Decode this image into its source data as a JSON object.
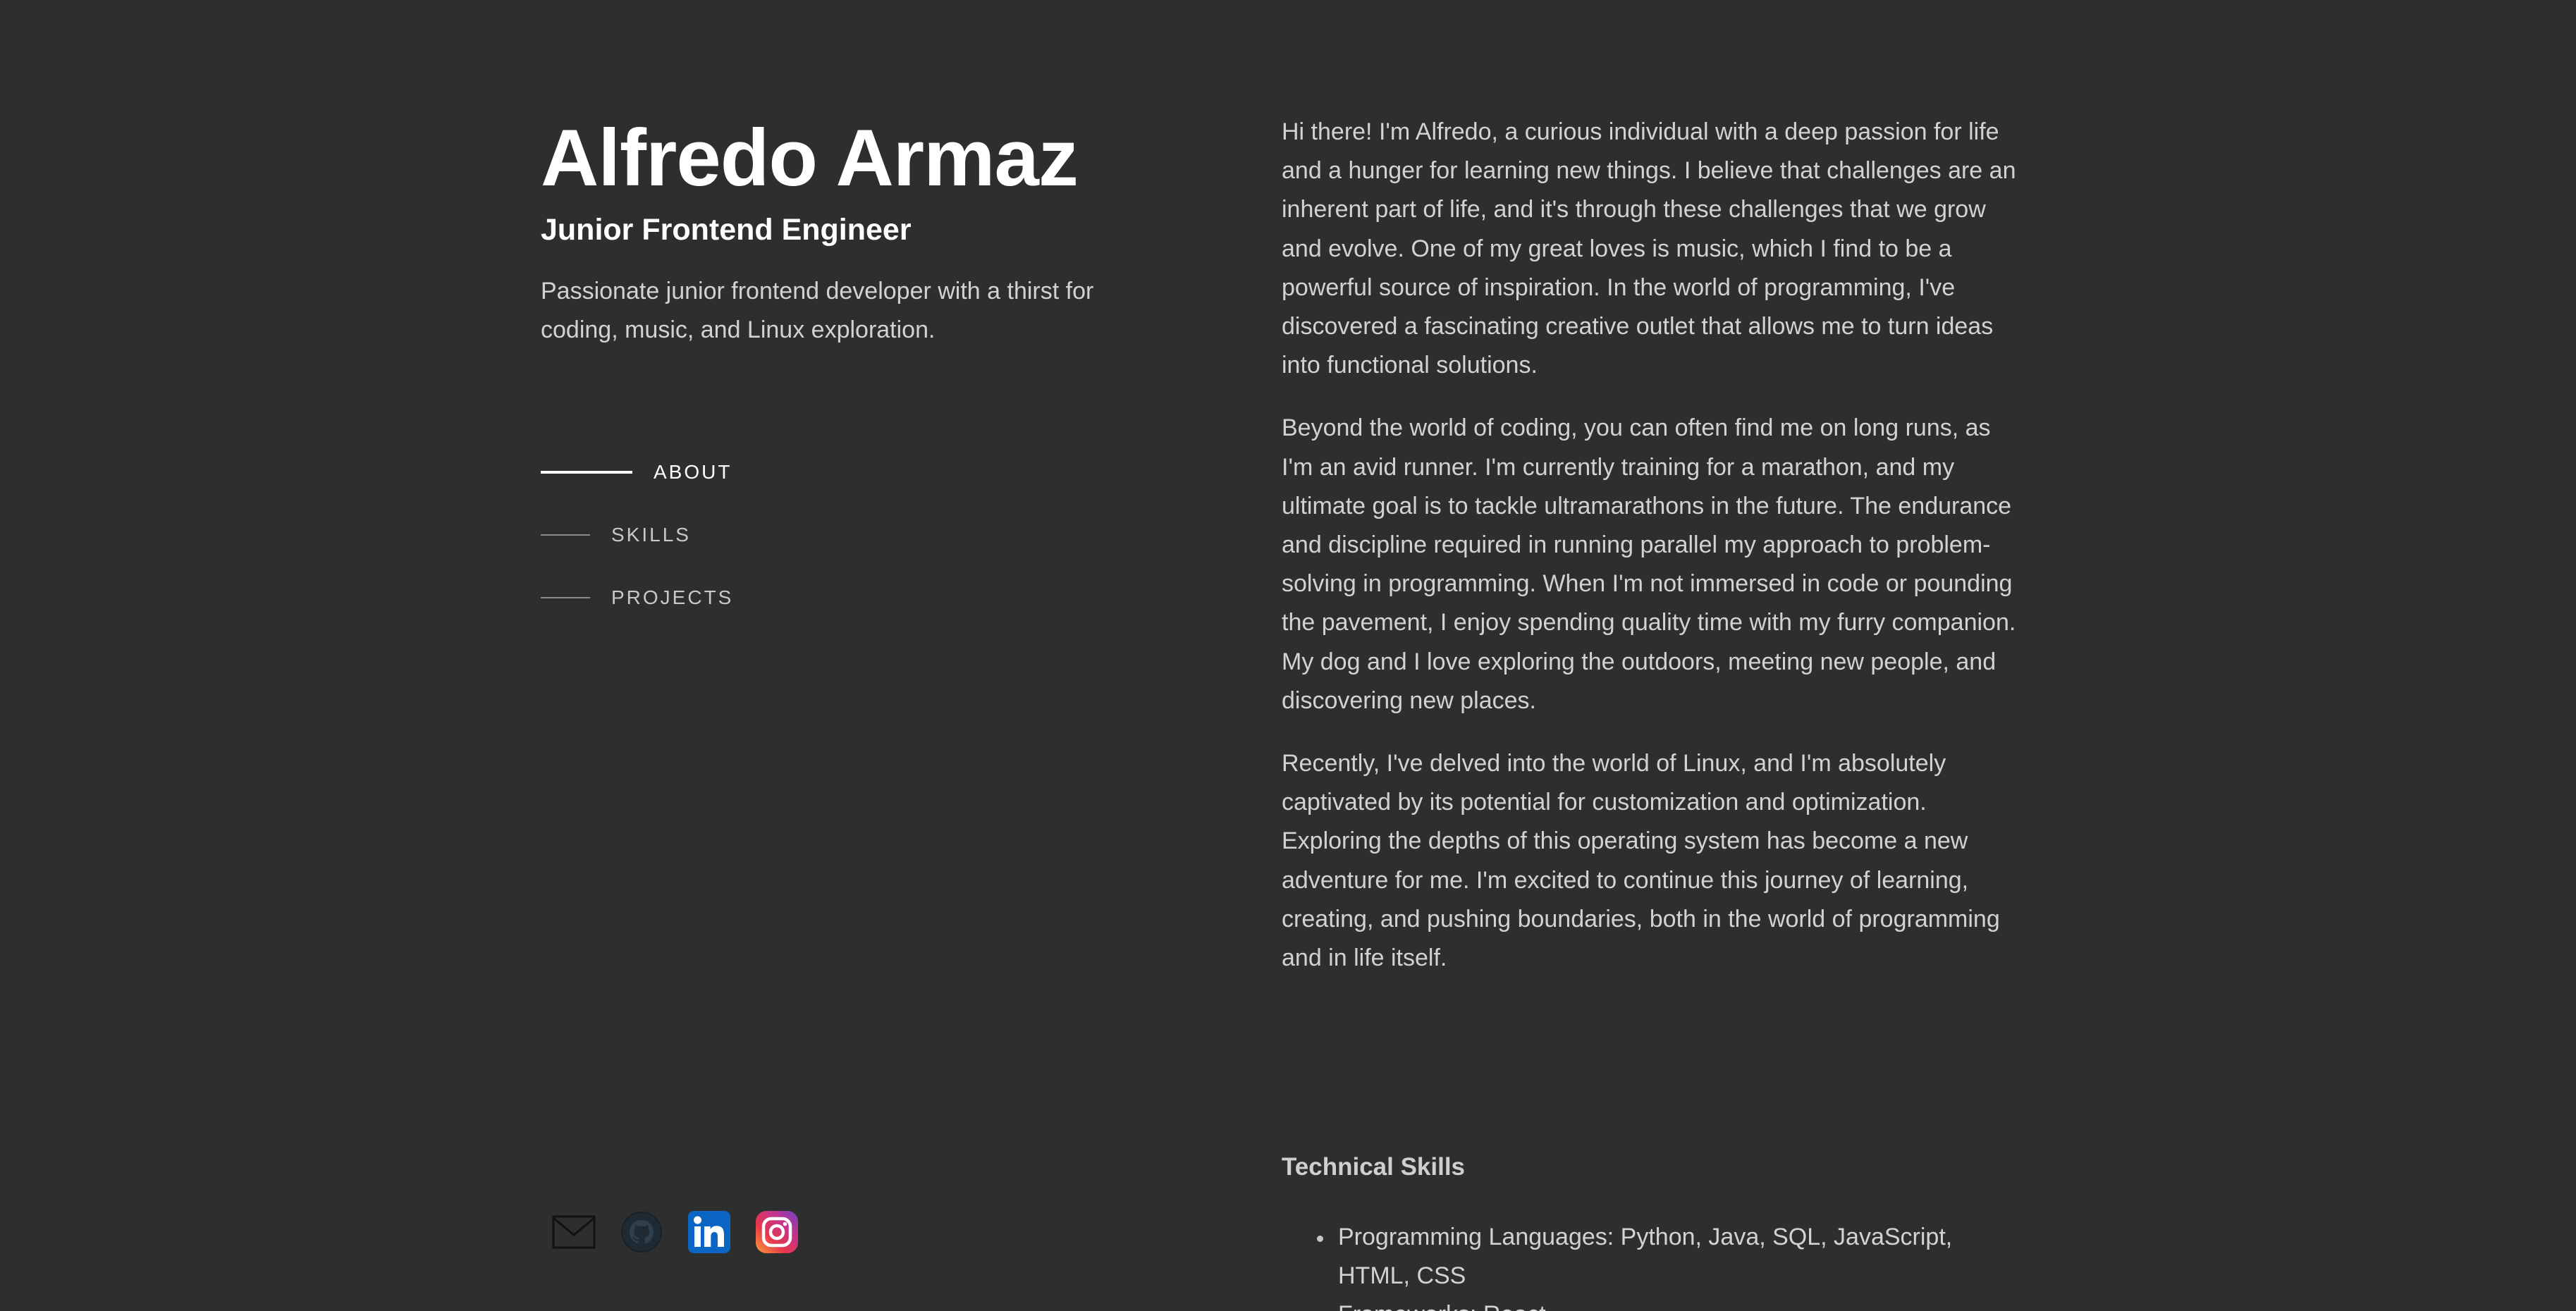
{
  "header": {
    "name": "Alfredo Armaz",
    "role": "Junior Frontend Engineer",
    "tagline": "Passionate junior frontend developer with a thirst for coding, music, and Linux exploration."
  },
  "nav": {
    "items": [
      {
        "label": "ABOUT",
        "active": true
      },
      {
        "label": "SKILLS",
        "active": false
      },
      {
        "label": "PROJECTS",
        "active": false
      }
    ]
  },
  "socials": [
    {
      "icon": "mail-icon"
    },
    {
      "icon": "github-icon"
    },
    {
      "icon": "linkedin-icon"
    },
    {
      "icon": "instagram-icon"
    }
  ],
  "about": {
    "paragraphs": [
      "Hi there! I'm Alfredo, a curious individual with a deep passion for life and a hunger for learning new things. I believe that challenges are an inherent part of life, and it's through these challenges that we grow and evolve. One of my great loves is music, which I find to be a powerful source of inspiration. In the world of programming, I've discovered a fascinating creative outlet that allows me to turn ideas into functional solutions.",
      "Beyond the world of coding, you can often find me on long runs, as I'm an avid runner. I'm currently training for a marathon, and my ultimate goal is to tackle ultramarathons in the future. The endurance and discipline required in running parallel my approach to problem-solving in programming. When I'm not immersed in code or pounding the pavement, I enjoy spending quality time with my furry companion. My dog and I love exploring the outdoors, meeting new people, and discovering new places.",
      "Recently, I've delved into the world of Linux, and I'm absolutely captivated by its potential for customization and optimization. Exploring the depths of this operating system has become a new adventure for me. I'm excited to continue this journey of learning, creating, and pushing boundaries, both in the world of programming and in life itself."
    ]
  },
  "skills": {
    "title": "Technical Skills",
    "items": [
      "Programming Languages: Python, Java, SQL, JavaScript, HTML, CSS",
      "Frameworks: React"
    ]
  },
  "colors": {
    "background": "#2e2e2e",
    "text": "#d2d2d2",
    "heading": "#ffffff",
    "linkedin": "#0a66c2"
  }
}
